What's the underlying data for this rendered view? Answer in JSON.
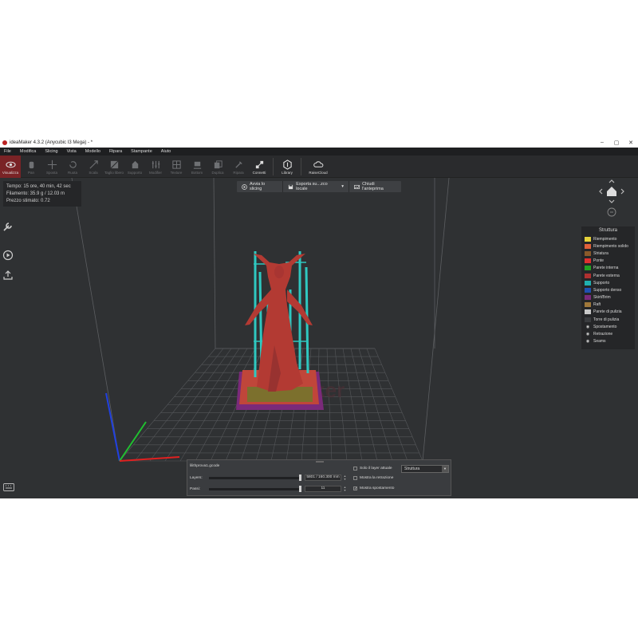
{
  "window": {
    "title": "ideaMaker 4.3.2 (Anycubic I3 Mega) - *",
    "minimize": "–",
    "maximize": "▢",
    "close": "✕"
  },
  "menu": [
    "File",
    "Modifica",
    "Slicing",
    "Vista",
    "Modello",
    "Ripara",
    "Stampante",
    "Aiuto"
  ],
  "toolbar": [
    {
      "label": "Visualizza",
      "icon": "eye-icon",
      "active": true
    },
    {
      "label": "Pan",
      "icon": "hand-icon"
    },
    {
      "label": "Sposta",
      "icon": "move-icon"
    },
    {
      "label": "Ruota",
      "icon": "rotate-icon"
    },
    {
      "label": "Scala",
      "icon": "scale-icon"
    },
    {
      "label": "Taglio libero",
      "icon": "cut-icon"
    },
    {
      "label": "Supporto",
      "icon": "support-icon"
    },
    {
      "label": "Modifier",
      "icon": "modifier-icon"
    },
    {
      "label": "Texture",
      "icon": "texture-icon"
    },
    {
      "label": "Bottom",
      "icon": "bottom-icon"
    },
    {
      "label": "Duplica",
      "icon": "duplicate-icon"
    },
    {
      "label": "Ripara",
      "icon": "repair-icon"
    },
    {
      "label": "Connetti",
      "icon": "connect-icon",
      "bright": true
    },
    {
      "label": "Library",
      "icon": "library-icon",
      "bright": true
    },
    {
      "label": "RaiseCloud",
      "icon": "cloud-icon",
      "bright": true
    }
  ],
  "stats": {
    "time": "Tempo: 15 ore, 40 min, 42 sec",
    "filament": "Filamento: 35.9 g / 12.03 m",
    "price": "Prezzo stimato: 0.72"
  },
  "slicebar": {
    "start": "Avvia lo slicing",
    "export": "Esporta su...zco locale",
    "close": "Chiudi l'anteprima"
  },
  "watermark": "ideaMaker",
  "legend": {
    "title": "Struttura",
    "items": [
      {
        "label": "Riempimento",
        "color": "#e5d23a"
      },
      {
        "label": "Riempimento solido",
        "color": "#e0603a"
      },
      {
        "label": "Striatura",
        "color": "#8a5a2a"
      },
      {
        "label": "Ponte",
        "color": "#e03030"
      },
      {
        "label": "Parete interna",
        "color": "#22a022"
      },
      {
        "label": "Parete esterna",
        "color": "#b03030"
      },
      {
        "label": "Supporto",
        "color": "#20b0b0"
      },
      {
        "label": "Supporto denso",
        "color": "#2050b0"
      },
      {
        "label": "Skirt/Brim",
        "color": "#7a2a7a"
      },
      {
        "label": "Raft",
        "color": "#a0783a"
      },
      {
        "label": "Parete di pulizia",
        "color": "#c8c8c8"
      },
      {
        "label": "Torre di pulizia",
        "color": "#3a3c3f"
      }
    ],
    "toggles": [
      "Spostamento",
      "Retrazione",
      "Seams"
    ]
  },
  "layers": {
    "filename": "lilithprova1.gcode",
    "layer_label": "Layers:",
    "layer_value": "5801 / 160.300 mm",
    "layer_fraction": 1.0,
    "step_label": "Passi:",
    "step_value": "11",
    "step_fraction": 1.0,
    "only_current": "Solo il layer attuale",
    "show_retraction": "Mostra la retrazione",
    "show_travel": "Mostra spostamento",
    "view_mode": "Struttura"
  }
}
